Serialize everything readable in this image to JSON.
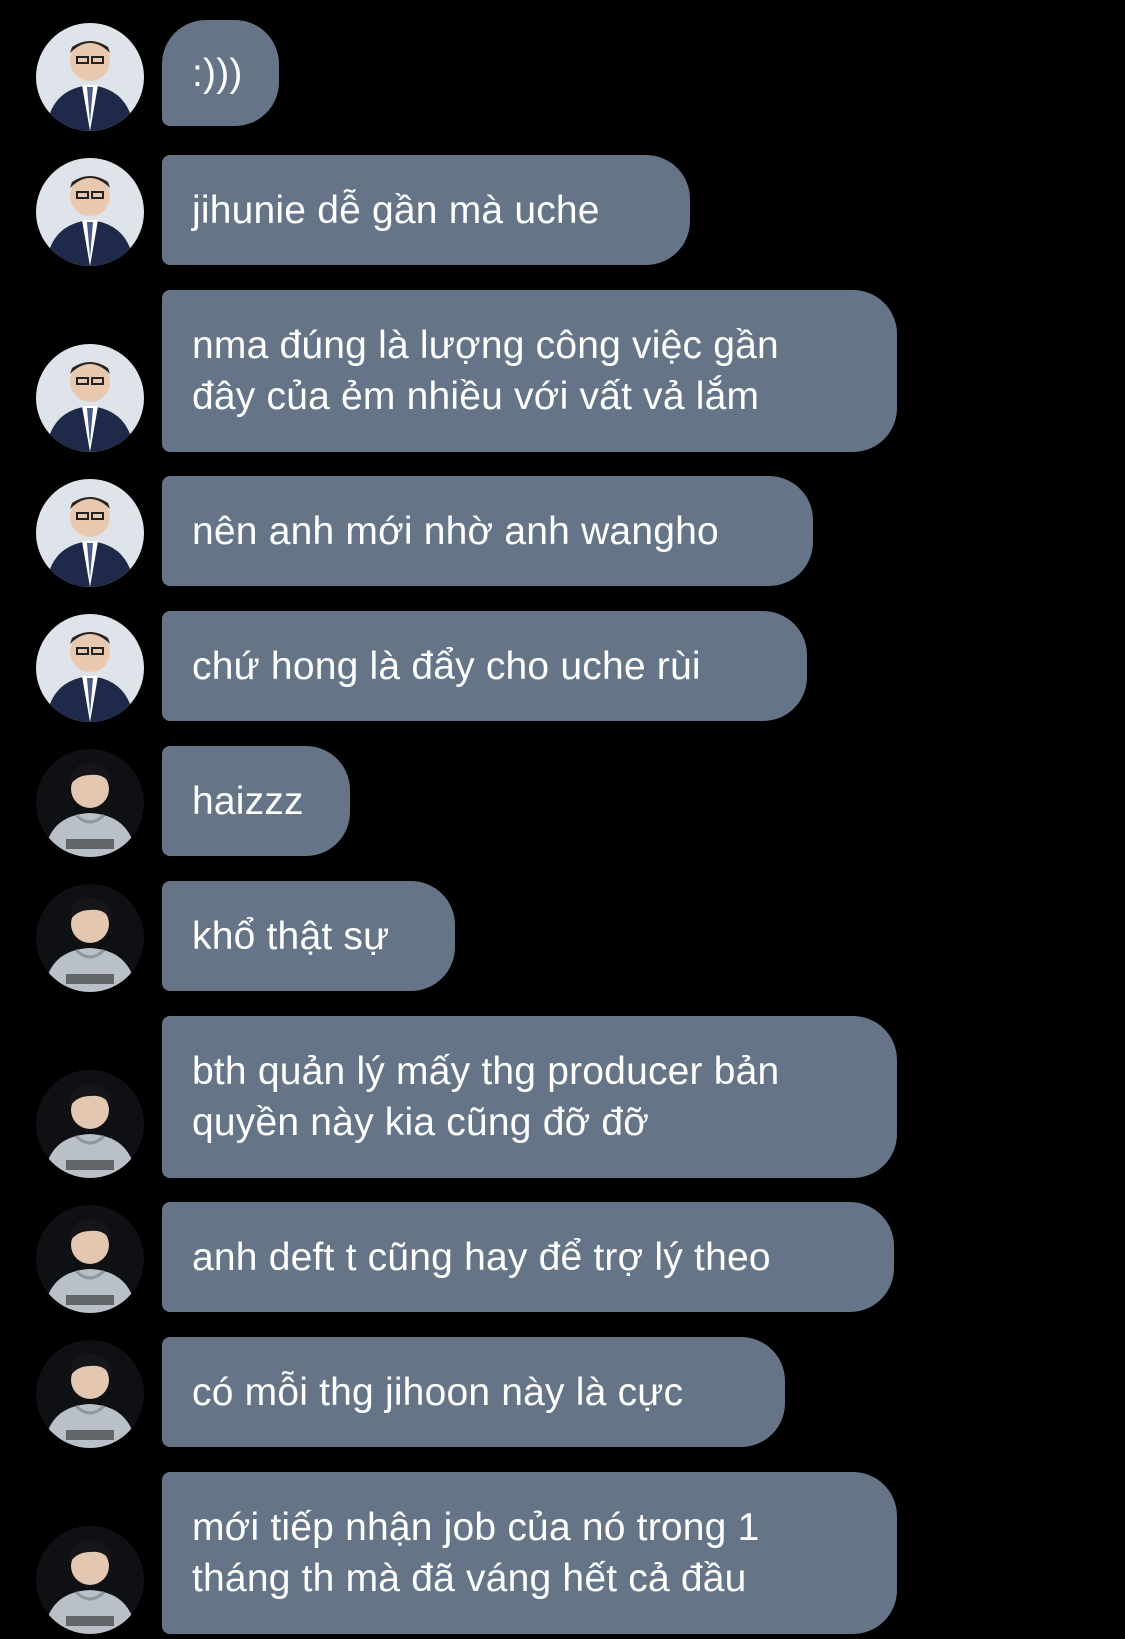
{
  "colors": {
    "background": "#000000",
    "bubble": "#657587",
    "bubble_text": "#ffffff"
  },
  "messages": [
    {
      "sender": "avatar-a",
      "lines": [
        ":)))"
      ]
    },
    {
      "sender": "avatar-a",
      "lines": [
        "jihunie dễ gần mà uche"
      ]
    },
    {
      "sender": "avatar-a",
      "lines": [
        "nma đúng là lượng công việc gần",
        "đây của ẻm nhiều với vất vả lắm"
      ]
    },
    {
      "sender": "avatar-a",
      "lines": [
        "nên anh mới nhờ anh wangho"
      ]
    },
    {
      "sender": "avatar-a",
      "lines": [
        "chứ hong là đẩy cho uche rùi"
      ]
    },
    {
      "sender": "avatar-b",
      "lines": [
        "haizzz"
      ]
    },
    {
      "sender": "avatar-b",
      "lines": [
        "khổ thật sự"
      ]
    },
    {
      "sender": "avatar-b",
      "lines": [
        "bth quản lý mấy thg producer bản",
        "quyền này kia cũng đỡ đỡ"
      ]
    },
    {
      "sender": "avatar-b",
      "lines": [
        "anh deft t cũng hay để trợ lý theo"
      ]
    },
    {
      "sender": "avatar-b",
      "lines": [
        "có mỗi thg jihoon này là cực"
      ]
    },
    {
      "sender": "avatar-b",
      "lines": [
        "mới tiếp nhận job của nó trong 1",
        "tháng th mà đã váng hết cả đầu"
      ]
    }
  ]
}
